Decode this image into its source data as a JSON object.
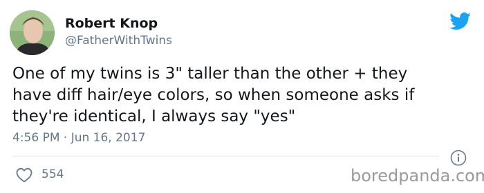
{
  "author": {
    "name": "Robert Knop",
    "handle": "@FatherWithTwins"
  },
  "tweet": {
    "text": "One of my twins is 3\" taller than the other + they\nhave diff hair/eye colors, so when someone asks if\nthey're identical, I always say \"yes\"",
    "timestamp": "4:56 PM · Jun 16, 2017",
    "like_count": "554"
  },
  "watermark": "boredpanda.com",
  "colors": {
    "twitter_blue": "#1da1f2",
    "text_primary": "#14171a",
    "text_secondary": "#657786"
  },
  "icons": [
    "twitter-bird-icon",
    "info-icon",
    "heart-icon"
  ]
}
